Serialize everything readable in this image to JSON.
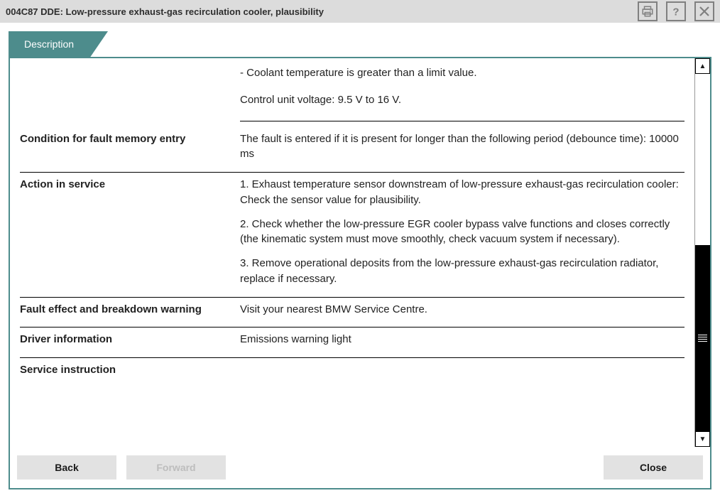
{
  "window": {
    "title": "004C87 DDE: Low-pressure exhaust-gas recirculation cooler, plausibility"
  },
  "tab": {
    "label": "Description"
  },
  "intro": {
    "line1": "- Coolant temperature is greater than a limit value.",
    "line2": "Control unit voltage: 9.5 V to 16 V."
  },
  "rows": {
    "condition": {
      "label": "Condition for fault memory entry",
      "value": "The fault is entered if it is present for longer than the following period (debounce time): 10000 ms"
    },
    "action": {
      "label": "Action in service",
      "p1": "1. Exhaust temperature sensor downstream of low-pressure exhaust-gas recirculation cooler: Check the sensor value for plausibility.",
      "p2": "2. Check whether the low-pressure EGR cooler bypass valve functions and closes correctly (the kinematic system must move smoothly, check vacuum system if necessary).",
      "p3": "3. Remove operational deposits from the low-pressure exhaust-gas recirculation radiator, replace if necessary."
    },
    "effect": {
      "label": "Fault effect and breakdown warning",
      "value": "Visit your nearest BMW Service Centre."
    },
    "driver": {
      "label": "Driver information",
      "value": "Emissions warning light"
    },
    "service": {
      "label": "Service instruction",
      "value": ""
    }
  },
  "buttons": {
    "back": "Back",
    "forward": "Forward",
    "close": "Close"
  }
}
